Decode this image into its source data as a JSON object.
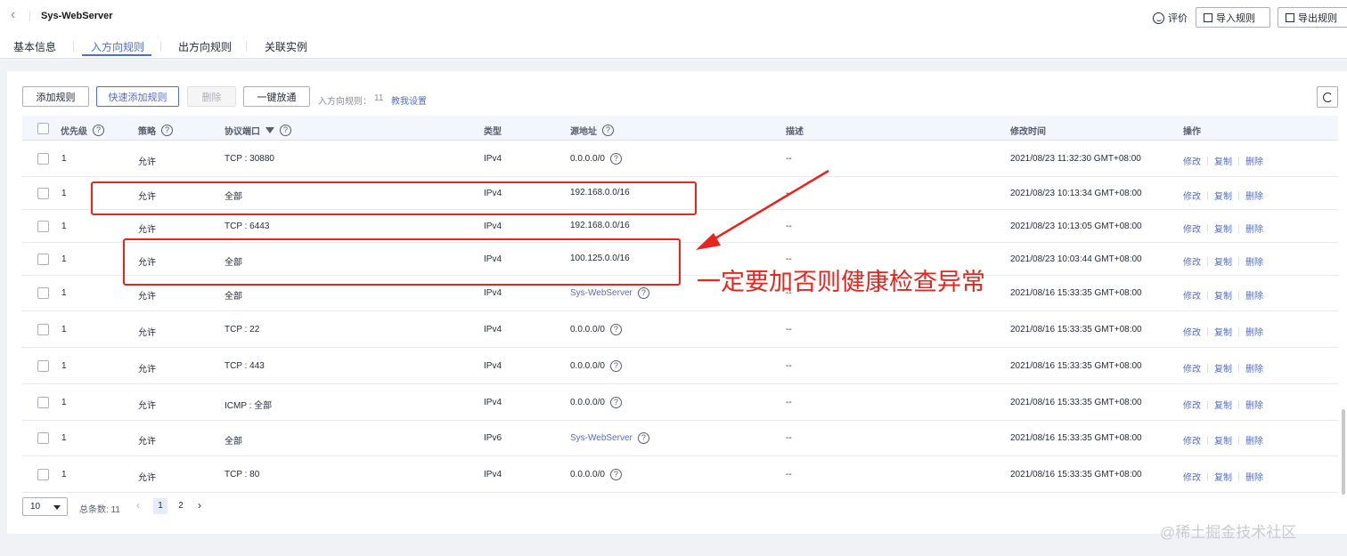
{
  "header": {
    "back_icon": "chevron-left-icon",
    "title": "Sys-WebServer",
    "eval_label": "评价",
    "import_label": "导入规则",
    "export_label": "导出规则"
  },
  "tabs": [
    "基本信息",
    "入方向规则",
    "出方向规则",
    "关联实例"
  ],
  "active_tab": "入方向规则",
  "toolbar": {
    "add_rule": "添加规则",
    "quick_add_rule": "快速添加规则",
    "delete": "删除",
    "one_click_allow": "一键放通",
    "rule_count_label": "入方向规则：",
    "rule_count": "11",
    "guide_link": "教我设置"
  },
  "table": {
    "columns": {
      "priority": "优先级",
      "policy": "策略",
      "protocol_port": "协议端口",
      "type": "类型",
      "source": "源地址",
      "description": "描述",
      "modified": "修改时间",
      "actions": "操作"
    },
    "action_labels": {
      "edit": "修改",
      "copy": "复制",
      "delete": "删除"
    },
    "rows": [
      {
        "priority": "1",
        "policy": "允许",
        "protocol_port": "TCP : 30880",
        "type": "IPv4",
        "source": "0.0.0.0/0",
        "source_link": false,
        "source_help": true,
        "description": "--",
        "modified": "2021/08/23 11:32:30 GMT+08:00"
      },
      {
        "priority": "1",
        "policy": "允许",
        "protocol_port": "全部",
        "type": "IPv4",
        "source": "192.168.0.0/16",
        "source_link": false,
        "source_help": false,
        "description": "--",
        "modified": "2021/08/23 10:13:34 GMT+08:00"
      },
      {
        "priority": "1",
        "policy": "允许",
        "protocol_port": "TCP : 6443",
        "type": "IPv4",
        "source": "192.168.0.0/16",
        "source_link": false,
        "source_help": false,
        "description": "--",
        "modified": "2021/08/23 10:13:05 GMT+08:00"
      },
      {
        "priority": "1",
        "policy": "允许",
        "protocol_port": "全部",
        "type": "IPv4",
        "source": "100.125.0.0/16",
        "source_link": false,
        "source_help": false,
        "description": "--",
        "modified": "2021/08/23 10:03:44 GMT+08:00"
      },
      {
        "priority": "1",
        "policy": "允许",
        "protocol_port": "全部",
        "type": "IPv4",
        "source": "Sys-WebServer",
        "source_link": true,
        "source_help": true,
        "description": "--",
        "modified": "2021/08/16 15:33:35 GMT+08:00"
      },
      {
        "priority": "1",
        "policy": "允许",
        "protocol_port": "TCP : 22",
        "type": "IPv4",
        "source": "0.0.0.0/0",
        "source_link": false,
        "source_help": true,
        "description": "--",
        "modified": "2021/08/16 15:33:35 GMT+08:00"
      },
      {
        "priority": "1",
        "policy": "允许",
        "protocol_port": "TCP : 443",
        "type": "IPv4",
        "source": "0.0.0.0/0",
        "source_link": false,
        "source_help": true,
        "description": "--",
        "modified": "2021/08/16 15:33:35 GMT+08:00"
      },
      {
        "priority": "1",
        "policy": "允许",
        "protocol_port": "ICMP : 全部",
        "type": "IPv4",
        "source": "0.0.0.0/0",
        "source_link": false,
        "source_help": true,
        "description": "--",
        "modified": "2021/08/16 15:33:35 GMT+08:00"
      },
      {
        "priority": "1",
        "policy": "允许",
        "protocol_port": "全部",
        "type": "IPv6",
        "source": "Sys-WebServer",
        "source_link": true,
        "source_help": true,
        "description": "--",
        "modified": "2021/08/16 15:33:35 GMT+08:00"
      },
      {
        "priority": "1",
        "policy": "允许",
        "protocol_port": "TCP : 80",
        "type": "IPv4",
        "source": "0.0.0.0/0",
        "source_link": false,
        "source_help": true,
        "description": "--",
        "modified": "2021/08/16 15:33:35 GMT+08:00"
      }
    ]
  },
  "pagination": {
    "page_size": "10",
    "total_label": "总条数: 11",
    "pages": [
      "1",
      "2"
    ],
    "current_page": "1"
  },
  "annotation": {
    "text": "一定要加否则健康检查异常",
    "color": "#e8241c"
  },
  "watermark": "@稀土掘金技术社区",
  "colors": {
    "accent": "#526ecc",
    "header_bg": "#f3f6fd",
    "annotation": "#e8241c"
  }
}
